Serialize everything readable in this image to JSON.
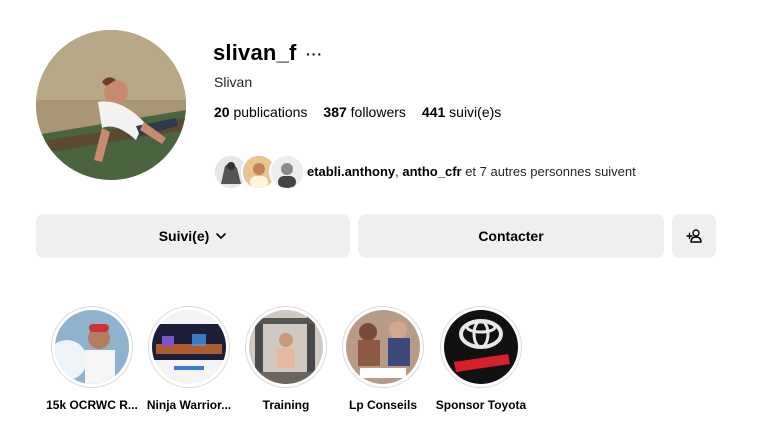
{
  "profile": {
    "username": "slivan_f",
    "more_label": "···",
    "full_name": "Slivan",
    "stats": [
      {
        "value": "20",
        "label": "publications"
      },
      {
        "value": "387",
        "label": "followers"
      },
      {
        "value": "441",
        "label": "suivi(e)s"
      }
    ],
    "followed_by": {
      "user1": "etabli.anthony",
      "separator": ", ",
      "user2": "antho_cfr",
      "suffix": " et 7 autres personnes suivent"
    }
  },
  "actions": {
    "follow_label": "Suivi(e)",
    "follow_chevron": "⌵",
    "contact_label": "Contacter",
    "add_user_icon": "add-person-icon"
  },
  "highlights": [
    {
      "label": "15k OCRWC R..."
    },
    {
      "label": "Ninja Warrior..."
    },
    {
      "label": "Training"
    },
    {
      "label": "Lp Conseils"
    },
    {
      "label": "Sponsor Toyota"
    }
  ],
  "colors": {
    "button_bg": "#efefef",
    "ring_border": "#dbdbdb",
    "text": "#000000",
    "secondary_text": "#262626"
  }
}
